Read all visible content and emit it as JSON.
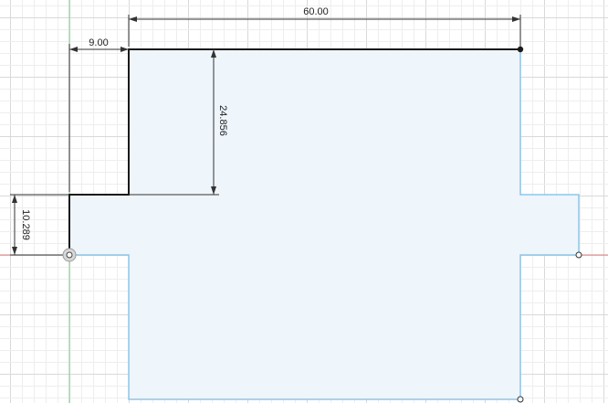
{
  "sketch": {
    "dimensions": {
      "overall_width": "60.00",
      "step_offset": "9.00",
      "step_height": "24.856",
      "flange_height": "10.289"
    },
    "colors": {
      "profile_fill": "#eef5fb",
      "profile_edge": "#8ec6e6",
      "constrained_edge": "#1a1a1a",
      "grid_minor": "#eeeeee",
      "grid_major": "#d9d9d9",
      "x_axis": "#e07f7f",
      "y_axis": "#7fd08a"
    }
  }
}
